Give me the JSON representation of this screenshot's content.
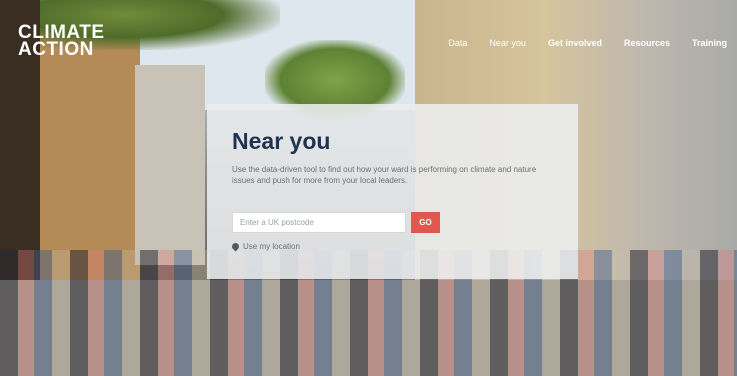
{
  "brand": {
    "logo_line1": "CLIMATE",
    "logo_line2": "ACTION"
  },
  "nav": {
    "items": [
      {
        "label": "Data"
      },
      {
        "label": "Near you"
      },
      {
        "label": "Get involved"
      },
      {
        "label": "Resources"
      },
      {
        "label": "Training"
      }
    ]
  },
  "hero": {
    "title": "Near you",
    "description": "Use the data-driven tool to find out how your ward is performing on climate and nature issues and push for more from your local leaders.",
    "search_placeholder": "Enter a UK postcode",
    "go_label": "GO",
    "location_label": "Use my location"
  },
  "colors": {
    "accent": "#e0584e",
    "title": "#1f3350"
  }
}
